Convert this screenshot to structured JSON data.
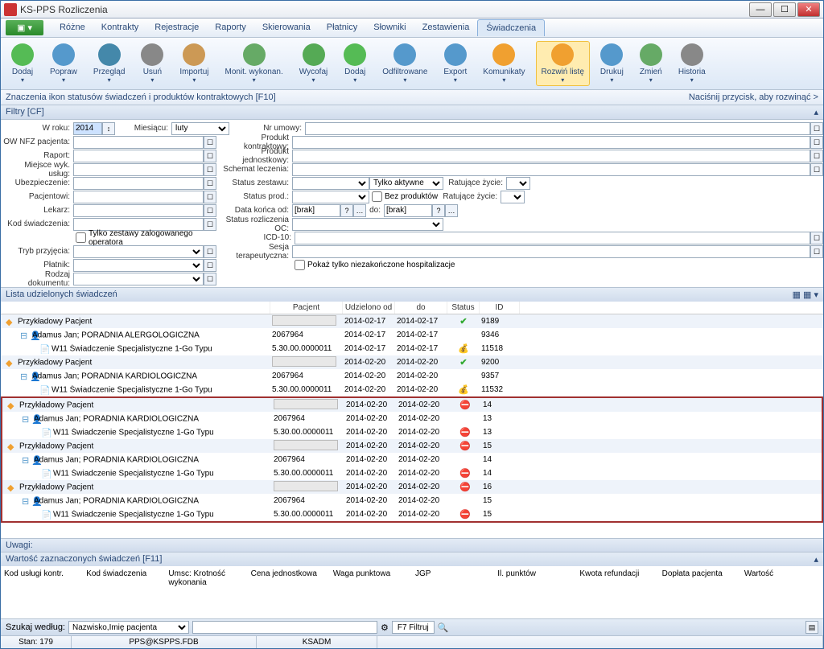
{
  "window": {
    "title": "KS-PPS Rozliczenia"
  },
  "menu": {
    "items": [
      "Różne",
      "Kontrakty",
      "Rejestracje",
      "Raporty",
      "Skierowania",
      "Płatnicy",
      "Słowniki",
      "Zestawienia",
      "Świadczenia"
    ],
    "active": 8
  },
  "toolbar": [
    {
      "label": "Dodaj",
      "color": "#5b5"
    },
    {
      "label": "Popraw",
      "color": "#59c"
    },
    {
      "label": "Przegląd",
      "color": "#48a"
    },
    {
      "label": "Usuń",
      "color": "#888"
    },
    {
      "label": "Importuj",
      "color": "#c95"
    },
    {
      "label": "Monit. wykonan.",
      "color": "#6a6"
    },
    {
      "label": "Wycofaj",
      "color": "#5a5"
    },
    {
      "label": "Dodaj",
      "color": "#5b5"
    },
    {
      "label": "Odfiltrowane",
      "color": "#59c"
    },
    {
      "label": "Export",
      "color": "#59c"
    },
    {
      "label": "Komunikaty",
      "color": "#f0a030"
    },
    {
      "label": "Rozwiń listę",
      "color": "#f0a030",
      "active": true
    },
    {
      "label": "Drukuj",
      "color": "#59c"
    },
    {
      "label": "Zmień",
      "color": "#6a6"
    },
    {
      "label": "Historia",
      "color": "#888"
    }
  ],
  "infobar": {
    "left": "Znaczenia ikon statusów świadczeń i produktów kontraktowych [F10]",
    "right": "Naciśnij przycisk, aby rozwinąć >"
  },
  "filters": {
    "header": "Filtry [CF]",
    "wroku_label": "W roku:",
    "wroku": "2014",
    "miesiac_label": "Miesiącu:",
    "miesiac": "luty",
    "nrumowy_label": "Nr umowy:",
    "ownfz_label": "OW NFZ pacjenta:",
    "prodkontr_label": "Produkt kontraktowy:",
    "raport_label": "Raport:",
    "prodjedn_label": "Produkt jednostkowy:",
    "miejsce_label": "Miejsce wyk. usług:",
    "schemat_label": "Schemat leczenia:",
    "ubezp_label": "Ubezpieczenie:",
    "statzest_label": "Status zestawu:",
    "tylkoakt": "Tylko aktywne",
    "ratujace_label": "Ratujące życie:",
    "pacjent_label": "Pacjentowi:",
    "statprod_label": "Status prod.:",
    "bezprod": "Bez produktów",
    "lekarz_label": "Lekarz:",
    "datakon_label": "Data końca od:",
    "brak": "[brak]",
    "do_label": "do:",
    "kodsw_label": "Kod świadczenia:",
    "statrozl_label": "Status rozliczenia OC:",
    "tylkozest": "Tylko zestawy zalogowanego operatora",
    "icd10_label": "ICD-10:",
    "trybprz_label": "Tryb przyjęcia:",
    "sesjater_label": "Sesja terapeutyczna:",
    "platnik_label": "Płatnik:",
    "pokazhosp": "Pokaż tylko niezakończone hospitalizacje",
    "rodzajdok_label": "Rodzaj dokumentu:"
  },
  "list": {
    "header": "Lista udzielonych świadczeń",
    "cols": [
      "Pacjent",
      "Udzielono od",
      "do",
      "Status",
      "ID"
    ],
    "rows": [
      {
        "lvl": 0,
        "type": "pac",
        "name": "Przykładowy Pacjent",
        "pac": "__grey__",
        "d1": "2014-02-17",
        "d2": "2014-02-17",
        "st": "check",
        "id": "9189",
        "hl": false
      },
      {
        "lvl": 1,
        "type": "por",
        "name": "Adamus Jan; PORADNIA ALERGOLOGICZNA",
        "pac": "2067964",
        "d1": "2014-02-17",
        "d2": "2014-02-17",
        "st": "",
        "id": "9346",
        "hl": false
      },
      {
        "lvl": 2,
        "type": "sw",
        "name": "W11 Świadczenie Specjalistyczne 1-Go Typu",
        "pac": "5.30.00.0000011",
        "d1": "2014-02-17",
        "d2": "2014-02-17",
        "st": "bag",
        "id": "11518",
        "hl": false
      },
      {
        "lvl": 0,
        "type": "pac",
        "name": "Przykładowy Pacjent",
        "pac": "__grey__",
        "d1": "2014-02-20",
        "d2": "2014-02-20",
        "st": "check",
        "id": "9200",
        "hl": false
      },
      {
        "lvl": 1,
        "type": "por",
        "name": "Adamus Jan; PORADNIA KARDIOLOGICZNA",
        "pac": "2067964",
        "d1": "2014-02-20",
        "d2": "2014-02-20",
        "st": "",
        "id": "9357",
        "hl": false
      },
      {
        "lvl": 2,
        "type": "sw",
        "name": "W11 Świadczenie Specjalistyczne 1-Go Typu",
        "pac": "5.30.00.0000011",
        "d1": "2014-02-20",
        "d2": "2014-02-20",
        "st": "bag",
        "id": "11532",
        "hl": false
      },
      {
        "lvl": 0,
        "type": "pac",
        "name": "Przykładowy Pacjent",
        "pac": "__grey__",
        "d1": "2014-02-20",
        "d2": "2014-02-20",
        "st": "err",
        "id": "14",
        "hl": true
      },
      {
        "lvl": 1,
        "type": "por",
        "name": "Adamus Jan; PORADNIA KARDIOLOGICZNA",
        "pac": "2067964",
        "d1": "2014-02-20",
        "d2": "2014-02-20",
        "st": "",
        "id": "13",
        "hl": true
      },
      {
        "lvl": 2,
        "type": "sw",
        "name": "W11 Świadczenie Specjalistyczne 1-Go Typu",
        "pac": "5.30.00.0000011",
        "d1": "2014-02-20",
        "d2": "2014-02-20",
        "st": "err",
        "id": "13",
        "hl": true
      },
      {
        "lvl": 0,
        "type": "pac",
        "name": "Przykładowy Pacjent",
        "pac": "__grey__",
        "d1": "2014-02-20",
        "d2": "2014-02-20",
        "st": "err",
        "id": "15",
        "hl": true
      },
      {
        "lvl": 1,
        "type": "por",
        "name": "Adamus Jan; PORADNIA KARDIOLOGICZNA",
        "pac": "2067964",
        "d1": "2014-02-20",
        "d2": "2014-02-20",
        "st": "",
        "id": "14",
        "hl": true
      },
      {
        "lvl": 2,
        "type": "sw",
        "name": "W11 Świadczenie Specjalistyczne 1-Go Typu",
        "pac": "5.30.00.0000011",
        "d1": "2014-02-20",
        "d2": "2014-02-20",
        "st": "err",
        "id": "14",
        "hl": true
      },
      {
        "lvl": 0,
        "type": "pac",
        "name": "Przykładowy Pacjent",
        "pac": "__grey__",
        "d1": "2014-02-20",
        "d2": "2014-02-20",
        "st": "err",
        "id": "16",
        "hl": true
      },
      {
        "lvl": 1,
        "type": "por",
        "name": "Adamus Jan; PORADNIA KARDIOLOGICZNA",
        "pac": "2067964",
        "d1": "2014-02-20",
        "d2": "2014-02-20",
        "st": "",
        "id": "15",
        "hl": true
      },
      {
        "lvl": 2,
        "type": "sw",
        "name": "W11 Świadczenie Specjalistyczne 1-Go Typu",
        "pac": "5.30.00.0000011",
        "d1": "2014-02-20",
        "d2": "2014-02-20",
        "st": "err",
        "id": "15",
        "hl": true
      }
    ]
  },
  "uwagi": "Uwagi:",
  "val": {
    "header": "Wartość zaznaczonych świadczeń [F11]",
    "cols": [
      "Kod usługi kontr.",
      "Kod świadczenia",
      "Umsc: Krotność wykonania",
      "Cena jednostkowa",
      "Waga punktowa",
      "JGP",
      "Il. punktów",
      "Kwota refundacji",
      "Dopłata pacjenta",
      "Wartość"
    ]
  },
  "search": {
    "label": "Szukaj według:",
    "mode": "Nazwisko,Imię pacjenta",
    "filter_btn": "F7 Filtruj"
  },
  "status": {
    "stan": "Stan: 179",
    "db": "PPS@KSPPS.FDB",
    "user": "KSADM"
  }
}
